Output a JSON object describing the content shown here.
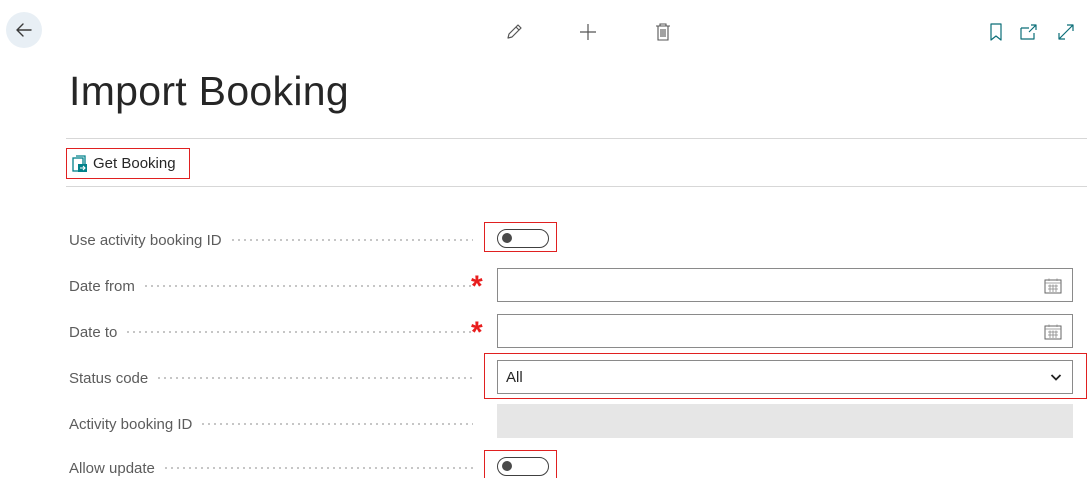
{
  "page": {
    "title": "Import Booking"
  },
  "actions": {
    "get_booking": "Get Booking"
  },
  "fields": {
    "use_activity_booking_id": {
      "label": "Use activity booking ID",
      "value": false
    },
    "date_from": {
      "label": "Date from",
      "value": "",
      "required": true
    },
    "date_to": {
      "label": "Date to",
      "value": "",
      "required": true
    },
    "status_code": {
      "label": "Status code",
      "value": "All"
    },
    "activity_booking_id": {
      "label": "Activity booking ID",
      "value": ""
    },
    "allow_update": {
      "label": "Allow update",
      "value": false
    }
  },
  "colors": {
    "accent": "#00818a",
    "highlight": "#e02020",
    "required": "#e81e1e"
  },
  "icons": [
    "back-arrow-icon",
    "edit-icon",
    "plus-icon",
    "trash-icon",
    "bookmark-icon",
    "open-in-new-icon",
    "expand-icon",
    "get-booking-icon",
    "calendar-icon",
    "chevron-down-icon"
  ]
}
